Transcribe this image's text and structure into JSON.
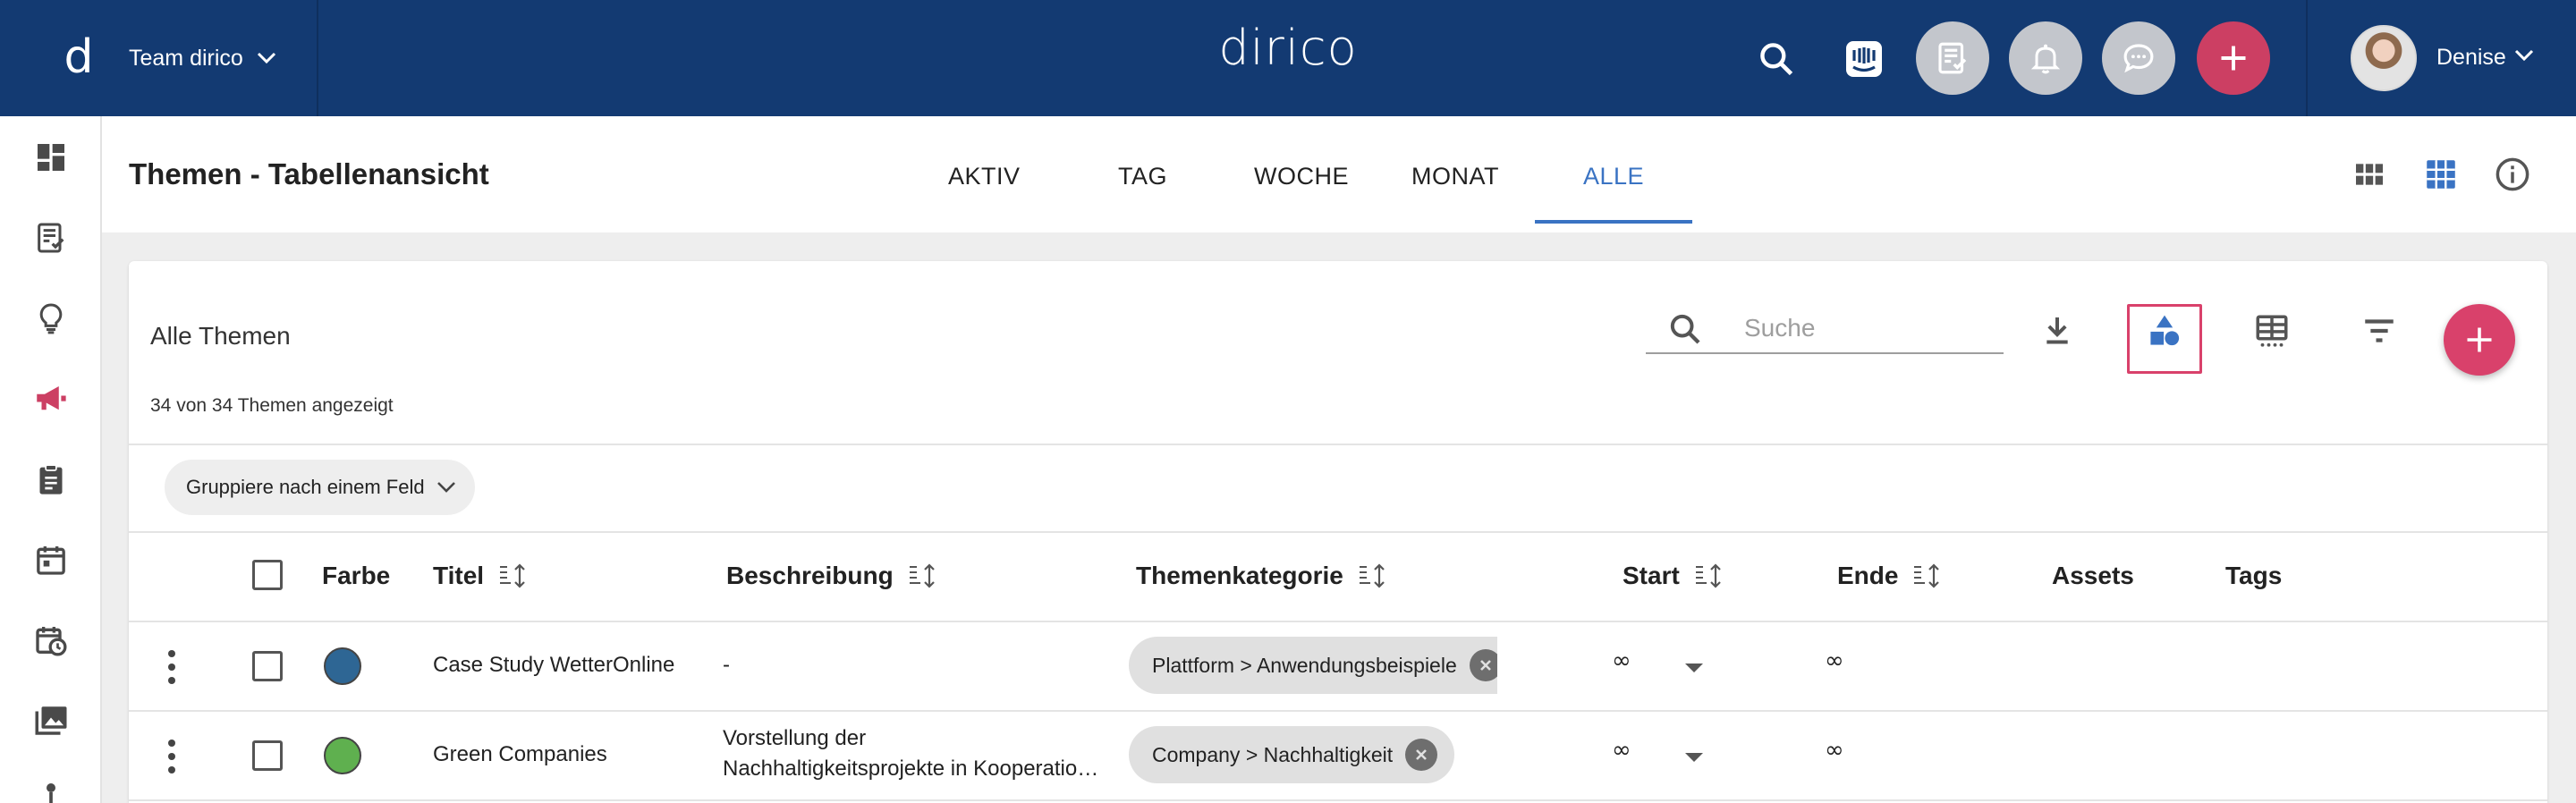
{
  "topbar": {
    "logo_letter": "d",
    "team_label": "Team dirico",
    "app_name": "dirico",
    "user_name": "Denise",
    "colors": {
      "background": "#133a72",
      "accent": "#cc3f63"
    }
  },
  "page": {
    "title": "Themen - Tabellenansicht",
    "tabs": [
      "AKTIV",
      "TAG",
      "WOCHE",
      "MONAT",
      "ALLE"
    ],
    "active_tab": "ALLE"
  },
  "card": {
    "title": "Alle Themen",
    "count_text": "34 von 34 Themen angezeigt",
    "search_placeholder": "Suche",
    "group_chip_label": "Gruppiere nach einem Feld"
  },
  "table": {
    "columns": [
      "Farbe",
      "Titel",
      "Beschreibung",
      "Themenkategorie",
      "Start",
      "Ende",
      "Assets",
      "Tags"
    ],
    "rows": [
      {
        "color": "#2e6694",
        "title": "Case Study WetterOnline",
        "description": "-",
        "description_line2": "",
        "category": "Plattform > Anwendungsbeispiele",
        "start": "∞",
        "end": "∞"
      },
      {
        "color": "#5fb04f",
        "title": "Green Companies",
        "description": "Vorstellung der",
        "description_line2": "Nachhaltigkeitsprojekte in Kooperatio…",
        "category": "Company > Nachhaltigkeit",
        "start": "∞",
        "end": "∞"
      }
    ]
  }
}
